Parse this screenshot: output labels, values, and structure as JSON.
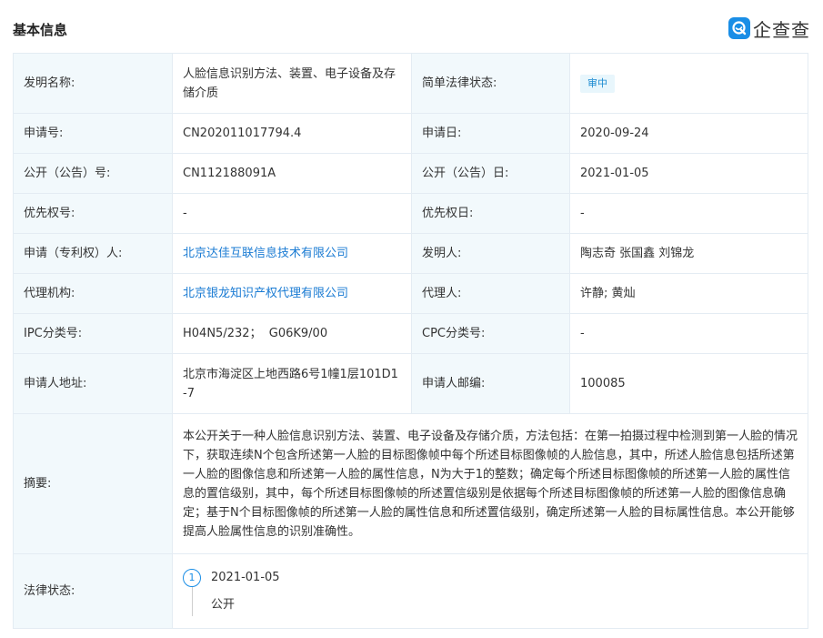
{
  "header": {
    "title": "基本信息",
    "brand": "企查查"
  },
  "colors": {
    "accent": "#1a8ee6",
    "label_bg": "#f2f9fc",
    "border": "#e4ecf3",
    "link": "#1a7bd3"
  },
  "fields": {
    "invention_name_label": "发明名称:",
    "invention_name": "人脸信息识别方法、装置、电子设备及存储介质",
    "legal_status_simple_label": "简单法律状态:",
    "legal_status_simple": "审中",
    "application_no_label": "申请号:",
    "application_no": "CN202011017794.4",
    "application_date_label": "申请日:",
    "application_date": "2020-09-24",
    "publication_no_label": "公开（公告）号:",
    "publication_no": "CN112188091A",
    "publication_date_label": "公开（公告）日:",
    "publication_date": "2021-01-05",
    "priority_no_label": "优先权号:",
    "priority_no": "-",
    "priority_date_label": "优先权日:",
    "priority_date": "-",
    "applicant_label": "申请（专利权）人:",
    "applicant": "北京达佳互联信息技术有限公司",
    "inventor_label": "发明人:",
    "inventor": "陶志奇 张国鑫 刘锦龙",
    "agency_label": "代理机构:",
    "agency": "北京银龙知识产权代理有限公司",
    "agent_label": "代理人:",
    "agent": "许静; 黄灿",
    "ipc_label": "IPC分类号:",
    "ipc": "H04N5/232；  G06K9/00",
    "cpc_label": "CPC分类号:",
    "cpc": "-",
    "address_label": "申请人地址:",
    "address": "北京市海淀区上地西路6号1幢1层101D1-7",
    "postcode_label": "申请人邮编:",
    "postcode": "100085",
    "abstract_label": "摘要:",
    "abstract": "本公开关于一种人脸信息识别方法、装置、电子设备及存储介质，方法包括：在第一拍摄过程中检测到第一人脸的情况下，获取连续N个包含所述第一人脸的目标图像帧中每个所述目标图像帧的人脸信息，其中，所述人脸信息包括所述第一人脸的图像信息和所述第一人脸的属性信息，N为大于1的整数；确定每个所述目标图像帧的所述第一人脸的属性信息的置信级别，其中，每个所述目标图像帧的所述置信级别是依据每个所述目标图像帧的所述第一人脸的图像信息确定；基于N个目标图像帧的所述第一人脸的属性信息和所述置信级别，确定所述第一人脸的目标属性信息。本公开能够提高人脸属性信息的识别准确性。",
    "legal_status_label": "法律状态:"
  },
  "timeline": [
    {
      "index": "1",
      "date": "2021-01-05",
      "status": "公开"
    }
  ]
}
